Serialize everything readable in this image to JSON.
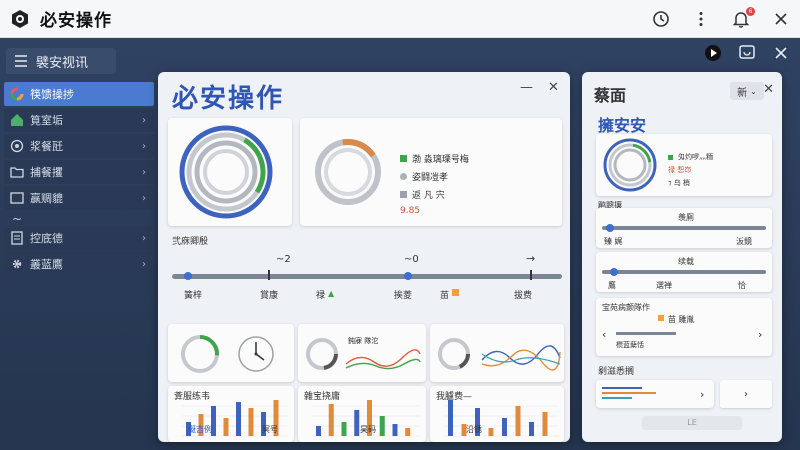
{
  "window": {
    "title": "必安操作",
    "notification_count": "6"
  },
  "workspace": {
    "head_label": "襞安视讯"
  },
  "sidebar": {
    "items": [
      {
        "label": "筷馈操捗",
        "active": true,
        "chevron": ""
      },
      {
        "label": "筧室垢",
        "active": false,
        "chevron": "›"
      },
      {
        "label": "浆餐瓩",
        "active": false,
        "chevron": "›"
      },
      {
        "label": "捕餐攫",
        "active": false,
        "chevron": "›"
      },
      {
        "label": "赢赒貔",
        "active": false,
        "chevron": "›"
      },
      {
        "label": "~",
        "active": false,
        "chevron": ""
      },
      {
        "label": "控底德",
        "active": false,
        "chevron": "›"
      },
      {
        "label": "叢蓝鷹",
        "active": false,
        "chevron": "›"
      }
    ]
  },
  "panel": {
    "title": "必安操作",
    "minimize": "—",
    "close": "✕",
    "donut_card": {
      "legend": [
        {
          "label": "渤   淼璃瑮号梅",
          "color": "#3fa44a"
        },
        {
          "label": "姿闘凒孝",
          "color": "#aab1bb"
        },
        {
          "label": "返  凡  宍",
          "color": "#9aa1aa"
        }
      ],
      "value": "9.85"
    },
    "section_label": "弐庥卿殷",
    "slider": {
      "markers": [
        "~2",
        "~0",
        "→"
      ],
      "labels": [
        "簧梓",
        "賞康",
        "禄",
        "挨菱",
        "苗",
        "拔费"
      ]
    },
    "mini_cards": [
      {
        "title": ""
      },
      {
        "title": "鈍寐 隊沱"
      },
      {
        "title": ""
      }
    ],
    "bar_charts": [
      {
        "title": "葊服练韦",
        "footer": "颬吉例"
      },
      {
        "title": "雜宝挠庸",
        "footer": "冥号"
      },
      {
        "title": "我臚费—",
        "footer": "沿锈"
      }
    ],
    "bar_footer_mid": "昊码"
  },
  "right_panel": {
    "title": "蔡面",
    "select_value": "新",
    "subtitle": "擁安安",
    "donut_legend": [
      "匁灼啰灬粫",
      "禄 惒岇",
      "⁊ 乌 梢"
    ],
    "track1": {
      "label_top": "羡厠",
      "labels": [
        "鹛聰攘",
        "臻  娓",
        "汳鏡"
      ]
    },
    "track2": {
      "label_top": "续载",
      "labels": [
        "鷹",
        "選禅",
        "恰"
      ]
    },
    "list_card": {
      "title": "宝苑病颤隊作",
      "item": "苗 雕胤",
      "arrow_left": "‹",
      "arrow_right": "›",
      "caption": "槚蓝蘖恬"
    },
    "section2": "剶滋悉搁",
    "bottom_card": {
      "arrow": "›"
    },
    "bottom_btn": "›",
    "footer": "LE"
  }
}
